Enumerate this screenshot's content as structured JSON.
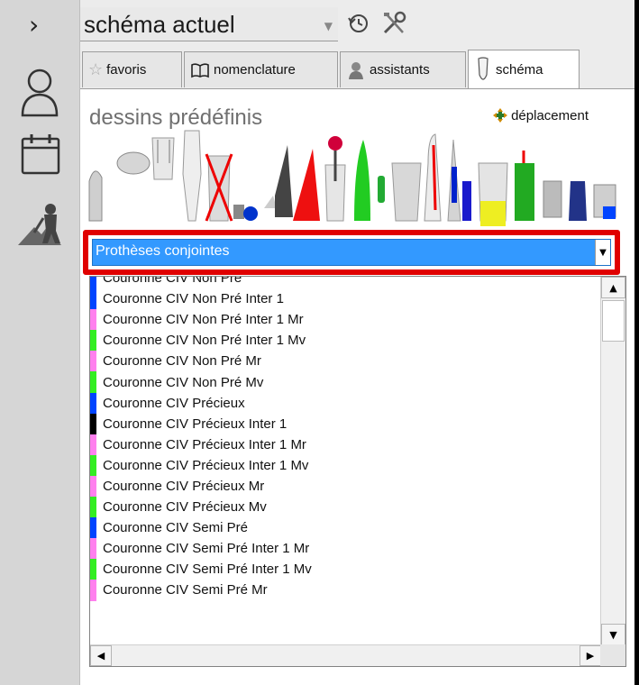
{
  "leftbar": {
    "chevron": "›",
    "icons": [
      "user-icon",
      "calendar-icon",
      "worker-icon"
    ]
  },
  "toolbar": {
    "view_select_value": "schéma actuel",
    "icons": [
      "history-icon",
      "tools-icon"
    ]
  },
  "tabs": [
    {
      "label": "favoris",
      "icon": "star-icon"
    },
    {
      "label": "nomenclature",
      "icon": "book-icon"
    },
    {
      "label": "assistants",
      "icon": "assistant-icon"
    },
    {
      "label": "schéma",
      "icon": "tooth-icon",
      "active": true
    }
  ],
  "schema": {
    "section_title": "dessins prédéfinis",
    "move_label": "déplacement"
  },
  "category": {
    "selected": "Prothèses conjointes"
  },
  "list": {
    "items": [
      {
        "label": "Couronne CIV Non Pré",
        "color": "#0044ff"
      },
      {
        "label": "Couronne CIV Non Pré Inter 1",
        "color": "#0044ff"
      },
      {
        "label": "Couronne CIV Non Pré Inter 1 Mr",
        "color": "#ff80ee"
      },
      {
        "label": "Couronne CIV Non Pré Inter 1 Mv",
        "color": "#33ee22"
      },
      {
        "label": "Couronne CIV Non Pré Mr",
        "color": "#ff80ee"
      },
      {
        "label": "Couronne CIV Non Pré Mv",
        "color": "#33ee22"
      },
      {
        "label": "Couronne CIV Précieux",
        "color": "#0044ff"
      },
      {
        "label": "Couronne CIV Précieux Inter 1",
        "color": "#000000"
      },
      {
        "label": "Couronne CIV Précieux Inter 1 Mr",
        "color": "#ff80ee"
      },
      {
        "label": "Couronne CIV Précieux Inter 1 Mv",
        "color": "#33ee22"
      },
      {
        "label": "Couronne CIV Précieux Mr",
        "color": "#ff80ee"
      },
      {
        "label": "Couronne CIV Précieux Mv",
        "color": "#33ee22"
      },
      {
        "label": "Couronne CIV Semi Pré",
        "color": "#0044ff"
      },
      {
        "label": "Couronne CIV Semi Pré Inter 1 Mr",
        "color": "#ff80ee"
      },
      {
        "label": "Couronne CIV Semi Pré Inter 1 Mv",
        "color": "#33ee22"
      },
      {
        "label": "Couronne CIV Semi Pré Mr",
        "color": "#ff80ee"
      }
    ]
  }
}
